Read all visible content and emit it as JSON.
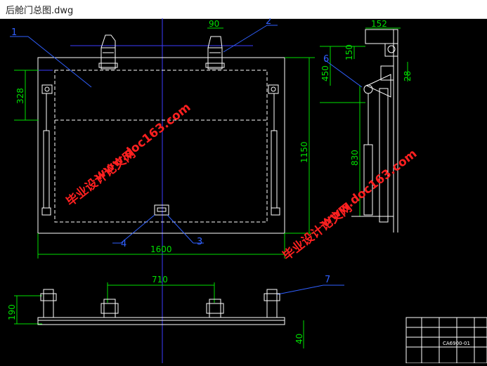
{
  "window": {
    "title": "后舱门总图.dwg"
  },
  "drawing": {
    "callouts": [
      "1",
      "2",
      "3",
      "4",
      "6",
      "7"
    ],
    "dimensions": {
      "top_width": "90",
      "left_height": "328",
      "overall_height": "1150",
      "overall_width": "1600",
      "bottom_span": "710",
      "bottom_height": "190",
      "bottom_thickness": "40",
      "side_width": "152",
      "side_150": "150",
      "side_450": "450",
      "side_830": "830",
      "side_28": "28"
    },
    "watermarks": [
      "毕业设计论文网",
      "www.doc163.com",
      "毕业设计论文网",
      "www.doc163.com"
    ],
    "title_block": {
      "drawing_no": "CA6900-01"
    }
  },
  "colors": {
    "line": "#ffffff",
    "dim": "#00ff00",
    "center": "#4040ff",
    "leader": "#3060ff",
    "watermark": "#ff2020"
  }
}
